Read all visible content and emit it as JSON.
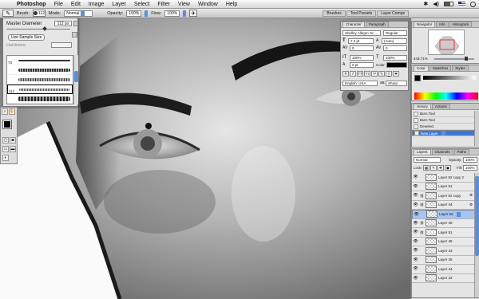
{
  "menubar": {
    "app_name": "Photoshop",
    "items": [
      "File",
      "Edit",
      "Image",
      "Layer",
      "Select",
      "Filter",
      "View",
      "Window",
      "Help"
    ],
    "status_icons": [
      "bluetooth-icon",
      "sound-icon",
      "battery-icon"
    ],
    "flag_label": "US"
  },
  "options_bar": {
    "brush_label": "Brush:",
    "brush_size": "112",
    "mode_label": "Mode:",
    "mode_value": "Normal",
    "opacity_label": "Opacity:",
    "opacity_value": "100%",
    "flow_label": "Flow:",
    "flow_value": "100%",
    "well_tabs": [
      "Brushes",
      "Tool Presets",
      "Layer Comps"
    ]
  },
  "brush_popup": {
    "master_diameter_label": "Master Diameter",
    "master_diameter_value": "112 px",
    "use_sample_size_label": "Use Sample Size",
    "hardness_label": "Hardness:",
    "brush_sizes": [
      "70",
      "",
      "",
      "112",
      "",
      ""
    ]
  },
  "character_panel": {
    "tabs": [
      "Character",
      "Paragraph"
    ],
    "font_family": "Shelley Allegro Sc...",
    "font_style": "Regular",
    "font_size": "7.2 pt",
    "leading": "(Auto)",
    "kerning": "0",
    "tracking": "0",
    "vertical_scale": "100%",
    "horizontal_scale": "100%",
    "baseline_shift": "0 pt",
    "color_label": "Color:",
    "language": "English: USA",
    "antialias_label": "aa",
    "antialias": "Sharp",
    "type_buttons": [
      "T",
      "T",
      "TT",
      "Tт",
      "T¹",
      "T₁",
      "T",
      "T"
    ]
  },
  "navigator_panel": {
    "tabs": [
      "Navigator",
      "Info",
      "Histogram"
    ],
    "zoom": "443.71%"
  },
  "color_panel": {
    "tabs": [
      "Color",
      "Swatches",
      "Styles"
    ]
  },
  "history_panel": {
    "tabs": [
      "History",
      "Actions"
    ],
    "items": [
      "Burn Tool",
      "Burn Tool",
      "Deselect",
      "New Layer"
    ],
    "selected_index": 3
  },
  "layers_panel": {
    "tabs": [
      "Layers",
      "Channels",
      "Paths"
    ],
    "blend_mode": "Normal",
    "opacity_label": "Opacity:",
    "opacity": "100%",
    "lock_label": "Lock:",
    "fill_label": "Fill:",
    "fill": "100%",
    "layers": [
      {
        "name": "Layer 52 copy 2",
        "linked": false,
        "fx": false
      },
      {
        "name": "Layer 51",
        "linked": false,
        "fx": false
      },
      {
        "name": "Layer 52 copy",
        "linked": true,
        "fx": true
      },
      {
        "name": "Layer 44",
        "linked": true,
        "fx": true
      },
      {
        "name": "Layer 52",
        "linked": false,
        "fx": false
      },
      {
        "name": "Layer 49",
        "linked": true,
        "fx": false
      },
      {
        "name": "Layer 51",
        "linked": true,
        "fx": false
      },
      {
        "name": "Layer 46",
        "linked": false,
        "fx": false
      },
      {
        "name": "Layer 43",
        "linked": false,
        "fx": false
      },
      {
        "name": "Layer 45",
        "linked": false,
        "fx": false
      },
      {
        "name": "Layer 44",
        "linked": false,
        "fx": false
      },
      {
        "name": "Layer 42",
        "linked": false,
        "fx": false
      }
    ],
    "selected_index": 4
  },
  "colors": {
    "selection_blue": "#3a78d8",
    "layer_selection": "#a6c4f2"
  }
}
